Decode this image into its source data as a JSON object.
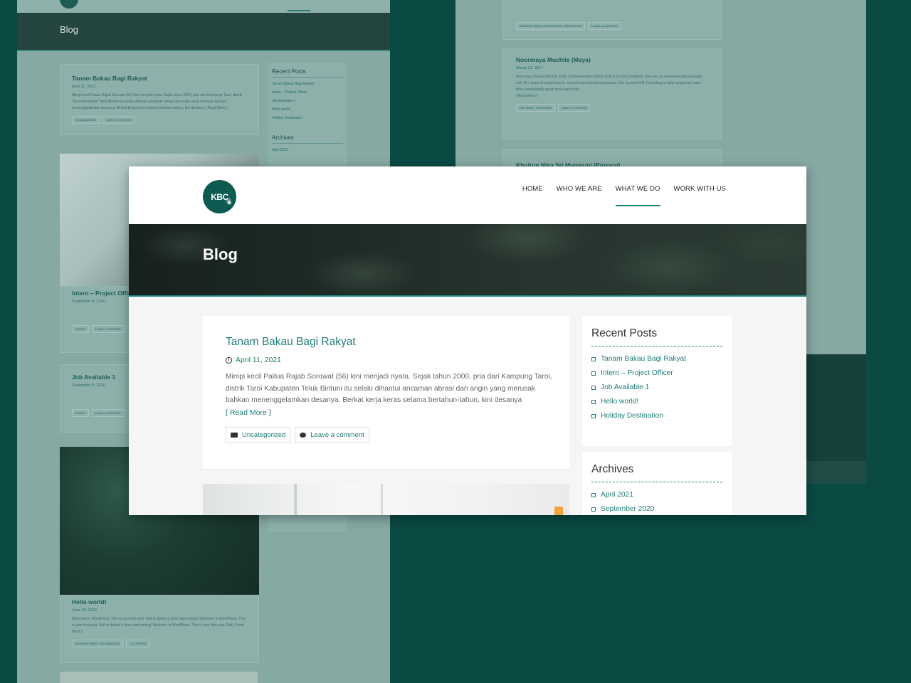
{
  "brand": {
    "logo_text": "KBC"
  },
  "nav": {
    "items": [
      "HOME",
      "WHO WE ARE",
      "WHAT WE DO",
      "WORK WITH US"
    ],
    "active": "WHAT WE DO"
  },
  "hero": {
    "title": "Blog"
  },
  "post": {
    "title": "Tanam Bakau Bagi Rakyat",
    "date": "April 11, 2021",
    "excerpt": "Mimpi kecil Paitua Rajab Sorowat (56) kini menjadi nyata. Sejak tahun 2000, pria dari Kampung Taroi, distrik Taroi Kabupaten Teluk Bintuni itu selalu dihantui ancaman abrasi dan angin yang merusak bahkan menenggelamkan desanya. Berkat kerja keras selama bertahun-tahun, kini desanya",
    "read_more": "[ Read More ]",
    "category": "Uncategorized",
    "comment": "Leave a comment"
  },
  "sidebar": {
    "recent_title": "Recent Posts",
    "recent": [
      "Tanam Bakau Bagi Rakyat",
      "Intern – Project Officer",
      "Job Available 1",
      "Hello world!",
      "Holiday Destination"
    ],
    "archives_title": "Archives",
    "archives": [
      "April 2021",
      "September 2020"
    ]
  },
  "background": {
    "left": {
      "hero_title": "Blog",
      "post1_title": "Tanam Bakau Bagi Rakyat",
      "post1_date": "April 11, 2021",
      "post2_title": "Intern – Project Officer",
      "post2_date": "September 8, 2020",
      "post3_title": "Job Available 1",
      "post3_date": "September 8, 2020",
      "post4_title": "Hello world!",
      "post4_date": "June 28, 2020",
      "post4_excerpt": "Welcome to WordPress. This is your first post. Edit or delete it, then start writing! Welcome to WordPress. This is your first post. Edit or delete it, then start writing! Welcome to WordPress. This is your first post. Edit [ Read More ]",
      "tags_business": "Business News, Uncategorized",
      "tag_one_comment": "1 Comment",
      "tag_career": "Career",
      "tag_uncategorized": "Uncategorized",
      "tag_leave": "Leave a comment",
      "side_recent": "Recent Posts",
      "side_archives": "Archives",
      "side_items": [
        "Tanam Bakau Bagi Rakyat",
        "Intern – Project Officer",
        "Job Available 1",
        "Hello world!",
        "Holiday Destination"
      ],
      "side_archive_item": "April 2021"
    },
    "right": {
      "card1_tags": [
        "Business News, Recent News, Recent Post",
        "Leave a comment"
      ],
      "card2_title": "Noormaya Muchlis (Maya)",
      "card2_date": "March 21, 2017",
      "card2_text": "Noormaya (Maya) Muchlis is the Chief Executive Officer (CEO) of KB Consulting. She was an environmental specialist with 15+ years of experience in several international companies. She founded KB Consulting to help companies meet their sustainability goals and support the",
      "card2_read": "[ Read More ]",
      "card2_tags": [
        "Our Team, Testimonial",
        "Leave a comment"
      ],
      "card3_title": "Khoirun Nisa Sri Mumpuni (Pupung)"
    }
  }
}
